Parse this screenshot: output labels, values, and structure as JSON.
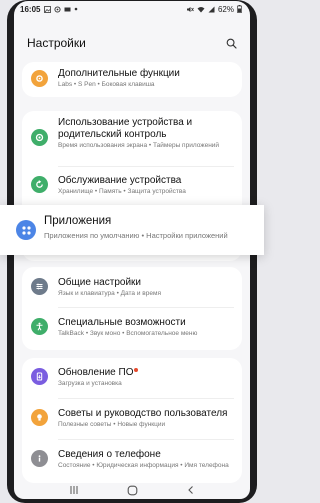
{
  "status_bar": {
    "time": "16:05",
    "battery": "62%"
  },
  "header": {
    "title": "Настройки"
  },
  "items": [
    {
      "title": "Дополнительные функции",
      "subtitle": "Labs  •  S Pen  •  Боковая клавиша",
      "icon": "gear-plus-icon",
      "color": "#f2a33b"
    },
    {
      "title": "Использование устройства и родительский контроль",
      "subtitle": "Время использования экрана  •  Таймеры приложений",
      "icon": "ring-icon",
      "color": "#3fae6a"
    },
    {
      "title": "Обслуживание устройства",
      "subtitle": "Хранилище  •  Память  •  Защита устройства",
      "icon": "refresh-icon",
      "color": "#3fae6a"
    },
    {
      "title": "Приложения",
      "subtitle": "Приложения по умолчанию  •  Настройки приложений",
      "icon": "apps-grid-icon",
      "color": "#4c85e6"
    },
    {
      "title": "Общие настройки",
      "subtitle": "Язык и клавиатура  •  Дата и время",
      "icon": "sliders-icon",
      "color": "#6e7b8b"
    },
    {
      "title": "Специальные возможности",
      "subtitle": "TalkBack  •  Звук моно  •  Вспомогательное меню",
      "icon": "accessibility-icon",
      "color": "#3fae6a"
    },
    {
      "title": "Обновление ПО",
      "subtitle": "Загрузка и установка",
      "icon": "update-icon",
      "color": "#7a5de0"
    },
    {
      "title": "Советы и руководство пользователя",
      "subtitle": "Полезные советы  •  Новые функции",
      "icon": "lightbulb-icon",
      "color": "#f2a33b"
    },
    {
      "title": "Сведения о телефоне",
      "subtitle": "Состояние  •  Юридическая информация  •  Имя телефона",
      "icon": "info-icon",
      "color": "#8e8e93"
    }
  ],
  "navbar": {
    "recent": "recent-apps-icon",
    "home": "home-icon",
    "back": "back-icon"
  }
}
